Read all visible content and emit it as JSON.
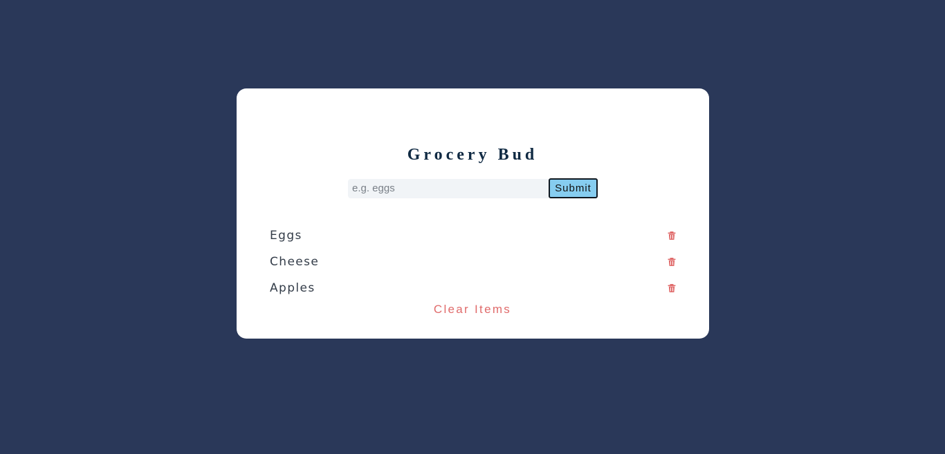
{
  "app": {
    "title": "Grocery Bud"
  },
  "form": {
    "input_value": "",
    "input_placeholder": "e.g. eggs",
    "submit_label": "Submit"
  },
  "items": [
    {
      "label": "Eggs",
      "delete_icon": "trash-icon"
    },
    {
      "label": "Cheese",
      "delete_icon": "trash-icon"
    },
    {
      "label": "Apples",
      "delete_icon": "trash-icon"
    }
  ],
  "clear_label": "Clear Items",
  "colors": {
    "background": "#2a3859",
    "card": "#ffffff",
    "title": "#102a43",
    "submit_bg": "#86cdf0",
    "danger": "#e06b6b"
  }
}
